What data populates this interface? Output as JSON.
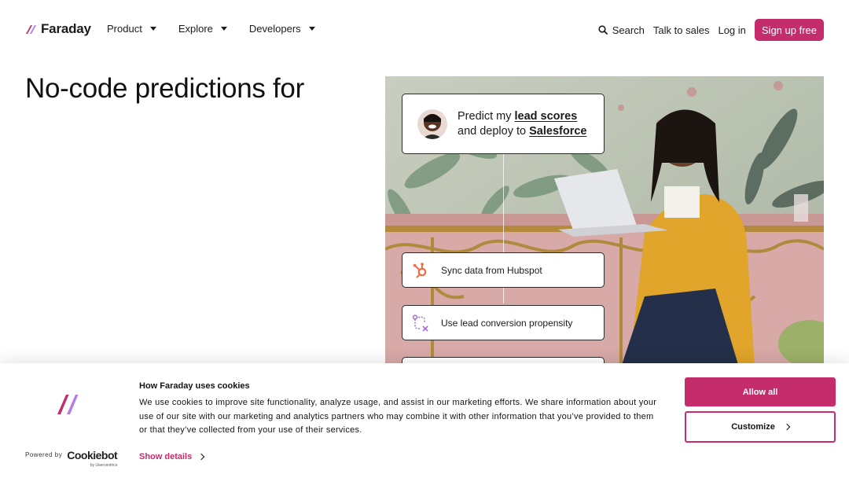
{
  "brand": {
    "name": "Faraday",
    "accent": "#c42c6b"
  },
  "nav": {
    "items": [
      {
        "label": "Product",
        "icon": "chevron-down-icon"
      },
      {
        "label": "Explore",
        "icon": "chevron-down-icon"
      },
      {
        "label": "Developers",
        "icon": "chevron-down-icon"
      }
    ],
    "search_label": "Search",
    "search_icon": "search-icon",
    "talk_label": "Talk to sales",
    "login_label": "Log in",
    "signup_label": "Sign up free"
  },
  "hero": {
    "title": "No-code predictions for",
    "card_main": {
      "prefix": "Predict my ",
      "highlight1": "lead scores",
      "middle": "and deploy to ",
      "highlight2": "Salesforce"
    },
    "steps": [
      {
        "label": "Sync data from Hubspot",
        "icon": "hubspot-icon"
      },
      {
        "label": "Use lead conversion propensity",
        "icon": "propensity-path-icon"
      }
    ]
  },
  "cookie": {
    "title": "How Faraday uses cookies",
    "body": "We use cookies to improve site functionality, analyze usage, and assist in our marketing efforts. We share information about your use of our site with our marketing and analytics partners who may combine it with other information that you’ve provided to them or that they’ve collected from your use of their services.",
    "show_details": "Show details",
    "allow_all": "Allow all",
    "customize": "Customize",
    "powered_by": "Powered by",
    "cookiebot": "Cookiebot",
    "cookiebot_sub": "by Usercentrics"
  }
}
